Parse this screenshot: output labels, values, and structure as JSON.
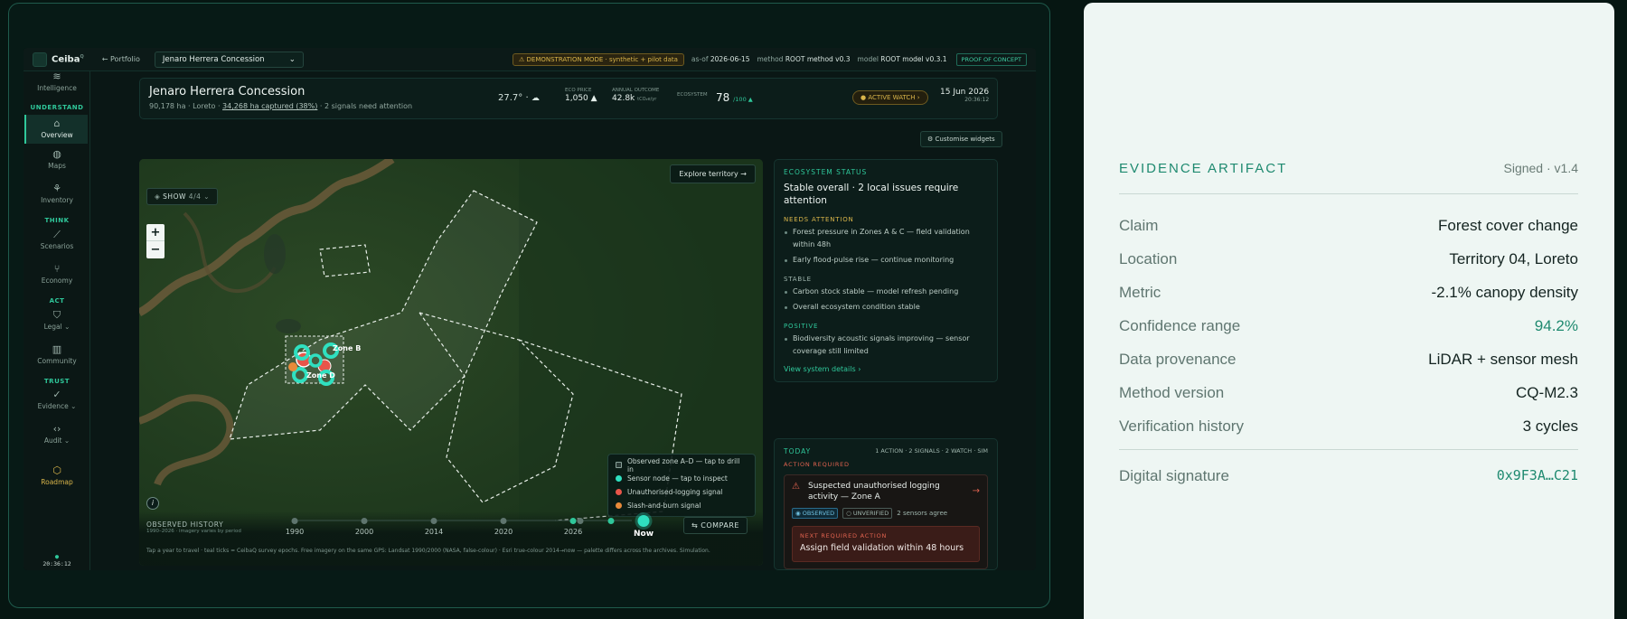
{
  "topbar": {
    "brand": "Ceiba",
    "brand_sup": "Q",
    "back": "← Portfolio",
    "concession": "Jenaro Herrera Concession",
    "demo": "⚠ DEMONSTRATION MODE · synthetic + pilot data",
    "asof_label": "as-of",
    "asof": "2026-06-15",
    "method_label": "method",
    "method": "ROOT method v0.3",
    "model_label": "model",
    "model": "ROOT model v0.3.1",
    "poc": "PROOF OF CONCEPT"
  },
  "sidebar": {
    "intelligence": "Intelligence",
    "understand": "UNDERSTAND",
    "overview": "Overview",
    "maps": "Maps",
    "inventory": "Inventory",
    "think": "THINK",
    "scenarios": "Scenarios",
    "economy": "Economy",
    "act": "ACT",
    "legal": "Legal ⌄",
    "community": "Community",
    "trust": "TRUST",
    "evidence": "Evidence ⌄",
    "audit": "Audit ⌄",
    "roadmap": "Roadmap",
    "clock": "20:36:12"
  },
  "header": {
    "title": "Jenaro Herrera Concession",
    "sub_a": "90,178 ha · Loreto · ",
    "sub_u": "34,268 ha captured (38%)",
    "sub_b": " · 2 signals need attention",
    "temp": "27.7° ·",
    "eco_price_label": "ECO PRICE",
    "eco_price": "1,050 ▲",
    "annual_label": "ANNUAL OUTCOME",
    "annual": "42.8k",
    "annual_unit": "tCO₂e/yr",
    "ecosystem_label": "ECOSYSTEM",
    "ecosystem": "78",
    "ecosystem_unit": "/100 ▲",
    "watch": "● ACTIVE WATCH ›",
    "date": "15 Jun 2026",
    "time": "20:36:12"
  },
  "customise": "⚙ Customise widgets",
  "map": {
    "show": "SHOW",
    "show_count": "4/4 ⌄",
    "explore": "Explore territory →",
    "zone_b": "Zone B",
    "zone_d": "Zone D",
    "legend": [
      "Observed zone A–D — tap to drill in",
      "Sensor node — tap to inspect",
      "Unauthorised-logging signal",
      "Slash-and-burn signal"
    ],
    "legend_colors": [
      "#2a3a36",
      "#2fe0c0",
      "#e8554a",
      "#e88a3a"
    ]
  },
  "timeline": {
    "label": "OBSERVED HISTORY",
    "range": "1990–2026 · imagery varies by period",
    "years": [
      "1990",
      "2000",
      "2014",
      "2020",
      "2026"
    ],
    "now": "Now",
    "compare": "⇆ COMPARE",
    "note": "Tap a year to travel · teal ticks = CeibaQ survey epochs. Free imagery on the same GPS: Landsat 1990/2000 (NASA, false-colour) · Esri true-colour 2014→now — palette differs across the archives. Simulation."
  },
  "status": {
    "head": "ECOSYSTEM STATUS",
    "title": "Stable overall · 2 local issues require attention",
    "needs": "NEEDS ATTENTION",
    "needs_items": [
      "Forest pressure in Zones A & C — field validation within 48h",
      "Early flood-pulse rise — continue monitoring"
    ],
    "stable": "STABLE",
    "stable_items": [
      "Carbon stock stable — model refresh pending",
      "Overall ecosystem condition stable"
    ],
    "positive": "POSITIVE",
    "positive_items": [
      "Biodiversity acoustic signals improving — sensor coverage still limited"
    ],
    "link": "View system details ›"
  },
  "today": {
    "head": "TODAY",
    "counts": "1 ACTION · 2 SIGNALS · 2 WATCH · SIM",
    "action": "ACTION REQUIRED",
    "alert": "Suspected unauthorised logging activity — Zone A",
    "chip1": "◉ OBSERVED",
    "chip2": "○ UNVERIFIED",
    "chip3": "2 sensors agree",
    "next_label": "NEXT REQUIRED ACTION",
    "next": "Assign field validation within 48 hours"
  },
  "evidence": {
    "head": "EVIDENCE ARTIFACT",
    "version": "Signed · v1.4",
    "rows": [
      {
        "k": "Claim",
        "v": "Forest cover change"
      },
      {
        "k": "Location",
        "v": "Territory 04, Loreto"
      },
      {
        "k": "Metric",
        "v": "-2.1% canopy density"
      },
      {
        "k": "Confidence range",
        "v": "94.2%"
      },
      {
        "k": "Data provenance",
        "v": "LiDAR + sensor mesh"
      },
      {
        "k": "Method version",
        "v": "CQ-M2.3"
      },
      {
        "k": "Verification history",
        "v": "3 cycles"
      }
    ],
    "sig_k": "Digital signature",
    "sig_v": "0x9F3A…C21"
  }
}
